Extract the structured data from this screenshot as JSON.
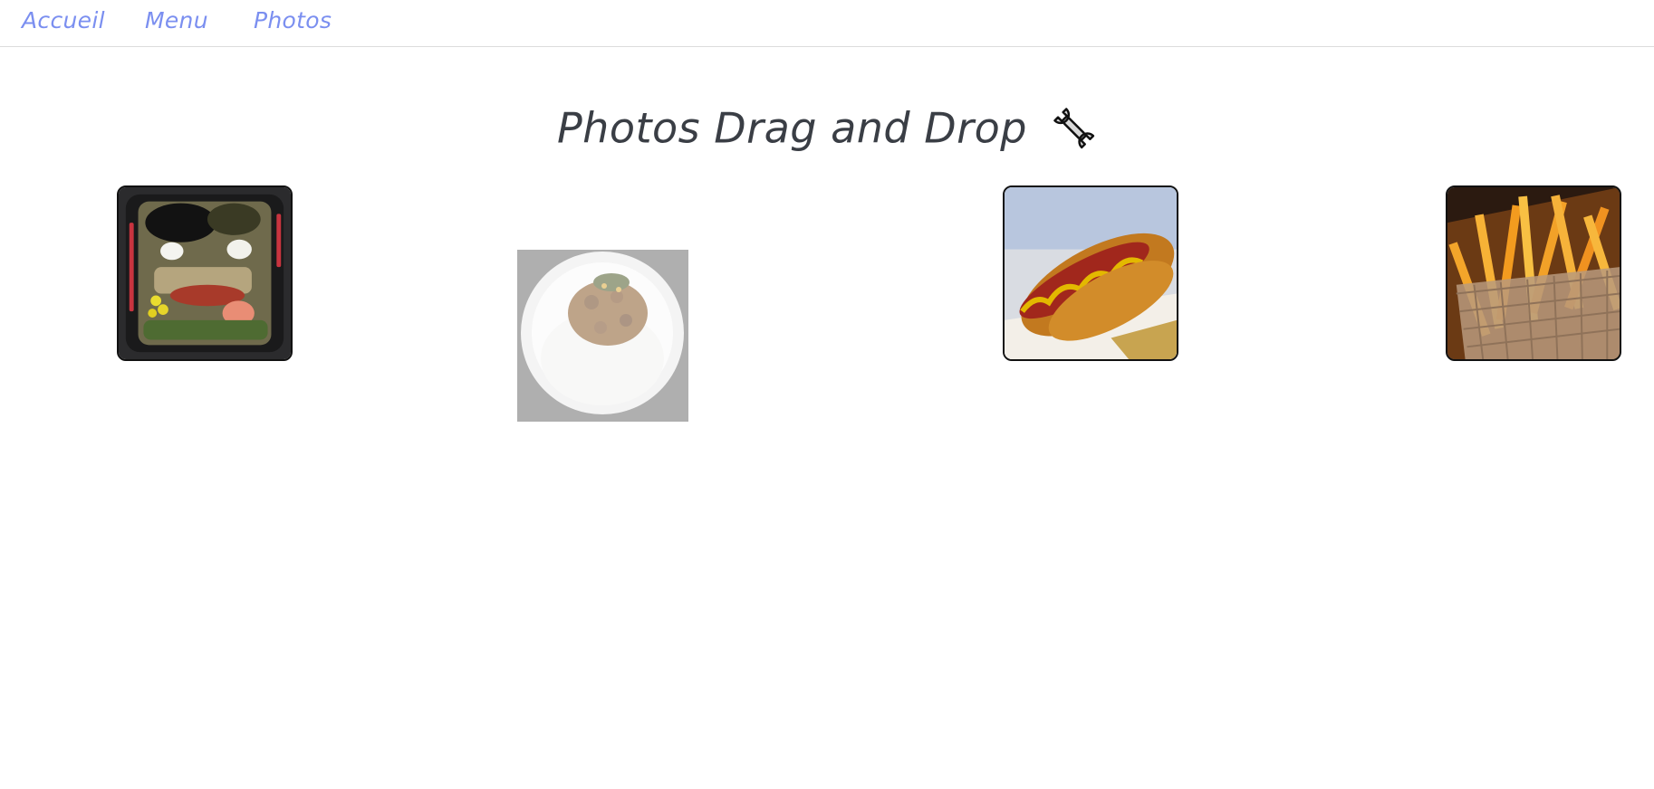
{
  "nav": {
    "items": [
      {
        "label": "Accueil"
      },
      {
        "label": "Menu"
      },
      {
        "label": "Photos"
      }
    ],
    "link_color": "#7b8ff0"
  },
  "page": {
    "title": "Photos Drag and Drop",
    "title_icon": "wrench-icon"
  },
  "photos": [
    {
      "name": "bento-face-photo",
      "state": "placed"
    },
    {
      "name": "natto-rice-photo",
      "state": "dragging"
    },
    {
      "name": "hot-dog-photo",
      "state": "placed"
    },
    {
      "name": "french-fries-photo",
      "state": "placed"
    }
  ]
}
